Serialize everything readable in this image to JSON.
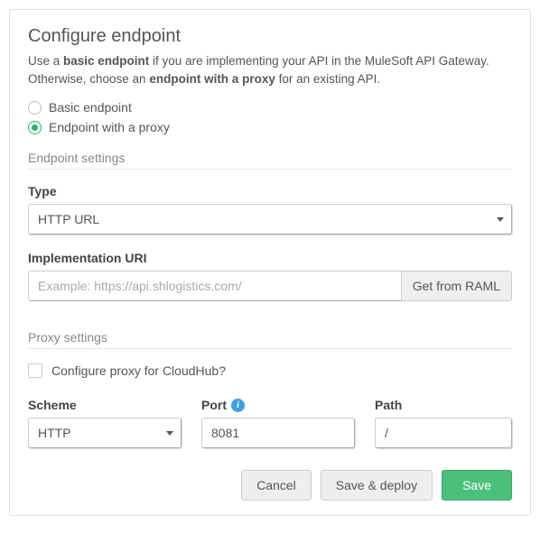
{
  "header": {
    "title": "Configure endpoint",
    "subtitle_parts": {
      "p1": "Use a ",
      "b1": "basic endpoint",
      "p2": " if you are implementing your API in the MuleSoft API Gateway. Otherwise, choose an ",
      "b2": "endpoint with a proxy",
      "p3": " for an existing API."
    }
  },
  "endpoint_choice": {
    "options": [
      {
        "label": "Basic endpoint",
        "selected": false
      },
      {
        "label": "Endpoint with a proxy",
        "selected": true
      }
    ]
  },
  "endpoint_settings": {
    "section_label": "Endpoint settings",
    "type_label": "Type",
    "type_value": "HTTP URL",
    "uri_label": "Implementation URI",
    "uri_value": "",
    "uri_placeholder": "Example: https://api.shlogistics.com/",
    "raml_button": "Get from RAML"
  },
  "proxy_settings": {
    "section_label": "Proxy settings",
    "cloudhub_label": "Configure proxy for CloudHub?",
    "cloudhub_checked": false,
    "scheme_label": "Scheme",
    "scheme_value": "HTTP",
    "port_label": "Port",
    "port_value": "8081",
    "path_label": "Path",
    "path_value": "/"
  },
  "footer": {
    "cancel": "Cancel",
    "save_deploy": "Save & deploy",
    "save": "Save"
  }
}
